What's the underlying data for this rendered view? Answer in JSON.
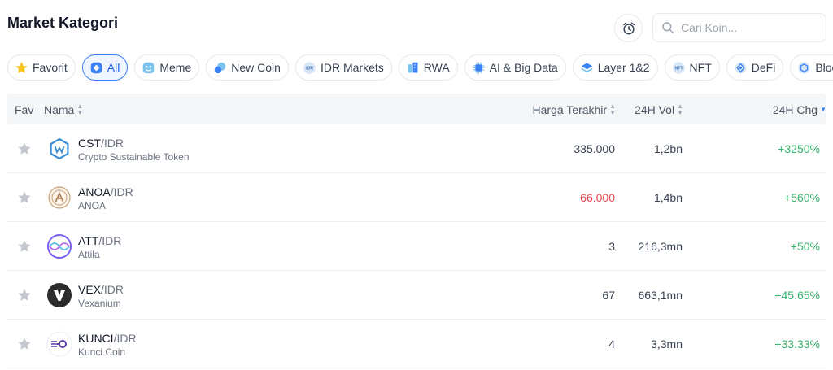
{
  "page": {
    "title": "Market Kategori"
  },
  "search": {
    "placeholder": "Cari Koin..."
  },
  "categories": [
    {
      "label": "Favorit",
      "icon": "star-icon",
      "active": false
    },
    {
      "label": "All",
      "icon": "all-icon",
      "active": true
    },
    {
      "label": "Meme",
      "icon": "meme-icon",
      "active": false
    },
    {
      "label": "New Coin",
      "icon": "new-coin-icon",
      "active": false
    },
    {
      "label": "IDR Markets",
      "icon": "idr-icon",
      "active": false
    },
    {
      "label": "RWA",
      "icon": "rwa-icon",
      "active": false
    },
    {
      "label": "AI & Big Data",
      "icon": "chip-icon",
      "active": false
    },
    {
      "label": "Layer 1&2",
      "icon": "layer-icon",
      "active": false
    },
    {
      "label": "NFT",
      "icon": "nft-icon",
      "active": false
    },
    {
      "label": "DeFi",
      "icon": "defi-icon",
      "active": false
    },
    {
      "label": "Blockchai",
      "icon": "blockchain-icon",
      "active": false
    }
  ],
  "table": {
    "headers": {
      "fav": "Fav",
      "name": "Nama",
      "price": "Harga Terakhir",
      "volume": "24H Vol",
      "change": "24H Chg"
    },
    "rows": [
      {
        "base": "CST",
        "quote": "/IDR",
        "name": "Crypto Sustainable Token",
        "price": "335.000",
        "price_color": "neutral",
        "volume": "1,2bn",
        "change": "+3250%"
      },
      {
        "base": "ANOA",
        "quote": "/IDR",
        "name": "ANOA",
        "price": "66.000",
        "price_color": "down",
        "volume": "1,4bn",
        "change": "+560%"
      },
      {
        "base": "ATT",
        "quote": "/IDR",
        "name": "Attila",
        "price": "3",
        "price_color": "neutral",
        "volume": "216,3mn",
        "change": "+50%"
      },
      {
        "base": "VEX",
        "quote": "/IDR",
        "name": "Vexanium",
        "price": "67",
        "price_color": "neutral",
        "volume": "663,1mn",
        "change": "+45.65%"
      },
      {
        "base": "KUNCI",
        "quote": "/IDR",
        "name": "Kunci Coin",
        "price": "4",
        "price_color": "neutral",
        "volume": "3,3mn",
        "change": "+33.33%"
      }
    ]
  },
  "colors": {
    "accent": "#3b82f6",
    "up": "#37b06b",
    "down": "#e5484d"
  }
}
